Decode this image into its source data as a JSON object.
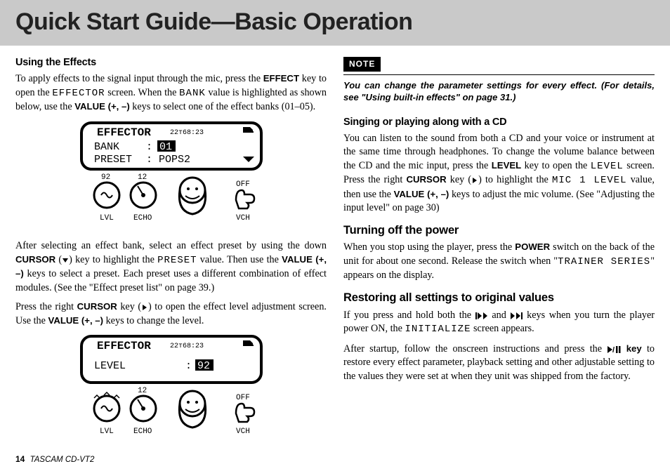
{
  "page_title": "Quick Start Guide—Basic Operation",
  "left": {
    "h_effects": "Using the Effects",
    "p1a": "To apply effects to the signal input through the mic, press the ",
    "p1b": " key to open the ",
    "p1c": " screen. When the ",
    "p1d": " value is highlighted as shown below, use the ",
    "p1e": " keys to select one of the effect banks (01–05).",
    "key_effect": "EFFECT",
    "lcd_effector": "EFFECTOR",
    "lcd_bank": "BANK",
    "key_value": "VALUE (+, –)",
    "fig1": {
      "title": "EFFECTOR",
      "time": "22т68:23",
      "bank_label": "BANK",
      "bank_val": "01",
      "preset_label": "PRESET",
      "preset_val": "POPS2",
      "lvl_label": "LVL",
      "echo_label": "ECHO",
      "vch_label": "VCH",
      "off_label": "OFF",
      "n1": "92",
      "n2": "12"
    },
    "p2a": "After selecting an effect bank, select an effect preset by using the down ",
    "p2b": " (",
    "p2c": ") key to highlight the ",
    "p2d": " value. Then use the ",
    "p2e": " keys to select a preset. Each preset uses a different combination of effect modules. (See the \"Effect preset list\" on page 39.)",
    "key_cursor": "CURSOR",
    "lcd_preset": "PRESET",
    "p3a": "Press the right ",
    "p3b": " key (",
    "p3c": ") to open the effect level adjustment screen. Use the ",
    "p3d": " keys to change the level.",
    "fig2": {
      "title": "EFFECTOR",
      "time": "22т68:23",
      "level_label": "LEVEL",
      "level_val": "92",
      "lvl_label": "LVL",
      "echo_label": "ECHO",
      "vch_label": "VCH",
      "off_label": "OFF",
      "n2": "12"
    }
  },
  "right": {
    "note_tag": "NOTE",
    "note_text": "You can change the parameter settings for every effect. (For details, see \"Using built-in effects\" on page 31.)",
    "h_singing": "Singing or playing along with a CD",
    "p1a": "You can listen to the sound from both a CD and your voice or instrument at the same time through headphones. To change the volume balance between the CD and the mic input, press the ",
    "p1b": " key to open the ",
    "p1c": " screen. Press the right ",
    "p1d": " key (",
    "p1e": ") to highlight the  ",
    "p1f": " value, then use the ",
    "p1g": " keys to adjust the mic volume. (See \"Adjusting the input level\" on page 30)",
    "key_level": "LEVEL",
    "lcd_level": "LEVEL",
    "lcd_mic": "MIC 1 LEVEL",
    "key_cursor": "CURSOR",
    "key_value": "VALUE (+, –)",
    "h_power": "Turning off the power",
    "p2a": "When you stop using the player, press the ",
    "p2b": " switch on the back of the unit for about one second. Release the switch when \"",
    "p2c": "\" appears on the display.",
    "key_power": "POWER",
    "lcd_trainer": "TRAINER SERIES",
    "h_restore": "Restoring all settings to original values",
    "p3a": "If you press and hold both the ",
    "p3b": " and ",
    "p3c": " keys when you turn the player power ON, the ",
    "p3d": " screen appears.",
    "lcd_init": "INITIALIZE",
    "p4a": "After startup, follow the onscreen instructions and press the ",
    "p4b": " to restore every effect parameter, playback setting and other adjustable setting to the values they were set at when they unit was shipped from the factory.",
    "key_playpause": " key"
  },
  "footer": {
    "page": "14",
    "product": "TASCAM  CD-VT2"
  }
}
